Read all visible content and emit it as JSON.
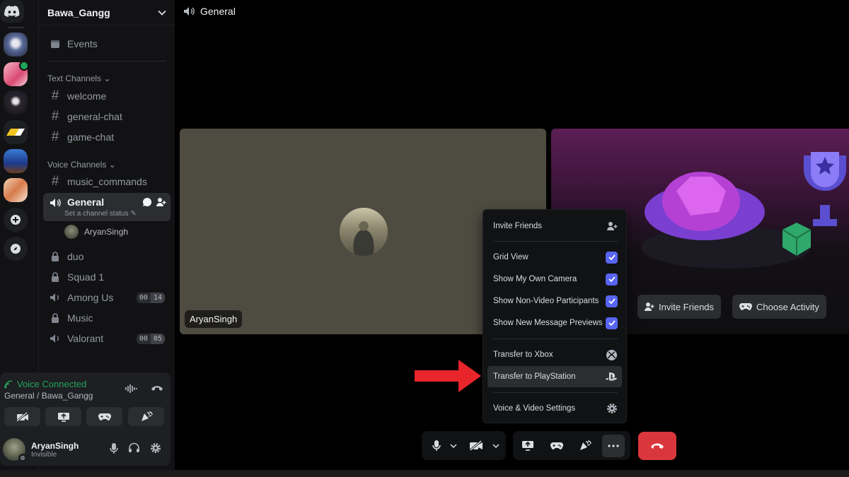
{
  "server": {
    "name": "Bawa_Gangg"
  },
  "sidebar": {
    "events_label": "Events",
    "text_category": "Text Channels",
    "text_channels": [
      "welcome",
      "general-chat",
      "game-chat"
    ],
    "voice_category": "Voice Channels",
    "music_commands": "music_commands",
    "active_channel": {
      "name": "General",
      "status_placeholder": "Set a channel status"
    },
    "voice_user": "AryanSingh",
    "locked": [
      {
        "name": "duo"
      },
      {
        "name": "Squad 1"
      }
    ],
    "among_us": {
      "name": "Among Us",
      "left": "00",
      "right": "14"
    },
    "music": "Music",
    "valorant": {
      "name": "Valorant",
      "left": "00",
      "right": "05"
    }
  },
  "voice_panel": {
    "status": "Voice Connected",
    "location": "General / Bawa_Gangg"
  },
  "user": {
    "name": "AryanSingh",
    "status": "Invisible"
  },
  "main": {
    "channel_title": "General",
    "tile_name": "AryanSingh",
    "invite_btn": "Invite Friends",
    "activity_btn": "Choose Activity"
  },
  "menu": {
    "invite": "Invite Friends",
    "grid_view": "Grid View",
    "own_camera": "Show My Own Camera",
    "non_video": "Show Non-Video Participants",
    "msg_previews": "Show New Message Previews",
    "xbox": "Transfer to Xbox",
    "playstation": "Transfer to PlayStation",
    "settings": "Voice & Video Settings"
  },
  "colors": {
    "accent": "#5865f2",
    "connected": "#23a55a",
    "hangup": "#da373c",
    "arrow": "#e8252a"
  }
}
